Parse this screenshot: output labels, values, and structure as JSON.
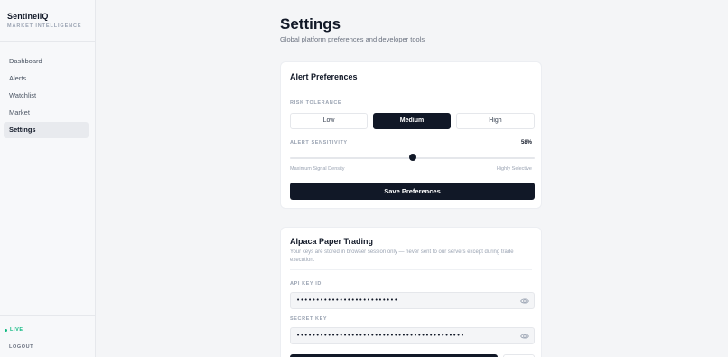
{
  "brand": {
    "name": "SentinelIQ",
    "subtitle": "MARKET INTELLIGENCE"
  },
  "sidebar": {
    "items": [
      {
        "label": "Dashboard",
        "active": false
      },
      {
        "label": "Alerts",
        "active": false
      },
      {
        "label": "Watchlist",
        "active": false
      },
      {
        "label": "Market",
        "active": false
      },
      {
        "label": "Settings",
        "active": true
      }
    ],
    "status_label": "LIVE",
    "logout_label": "LOGOUT"
  },
  "page": {
    "title": "Settings",
    "subtitle": "Global platform preferences and developer tools"
  },
  "alert_prefs": {
    "title": "Alert Preferences",
    "risk_label": "RISK TOLERANCE",
    "risk_options": [
      "Low",
      "Medium",
      "High"
    ],
    "risk_selected": "Medium",
    "sensitivity_label": "ALERT SENSITIVITY",
    "sensitivity_value": "58%",
    "sensitivity_fraction": 0.5,
    "slider_min_label": "Maximum Signal Density",
    "slider_max_label": "Highly Selective",
    "save_label": "Save Preferences"
  },
  "alpaca": {
    "title": "Alpaca Paper Trading",
    "description": "Your keys are stored in browser session only — never sent to our servers except during trade execution.",
    "api_key_label": "API KEY ID",
    "api_key_value": "••••••••••••••••••••••••••",
    "secret_key_label": "SECRET KEY",
    "secret_key_value": "•••••••••••••••••••••••••••••••••••••••••••"
  },
  "colors": {
    "accent": "#111827",
    "live": "#10b981",
    "background": "#f4f5f7"
  },
  "icons": {
    "reveal": "eye-icon"
  }
}
